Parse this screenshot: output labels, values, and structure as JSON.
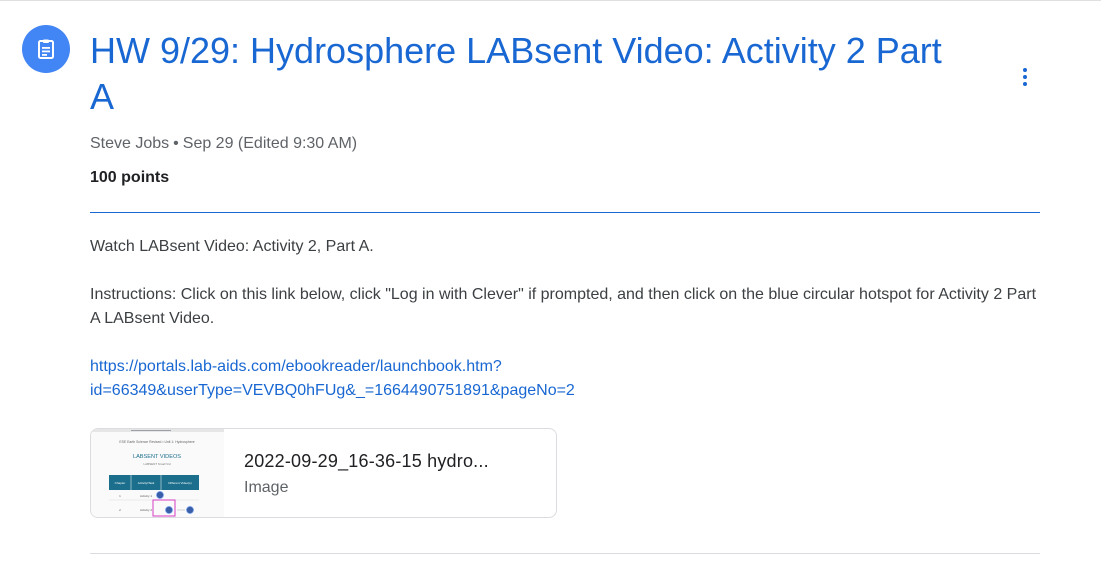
{
  "header": {
    "title": "HW 9/29: Hydrosphere LABsent Video: Activity 2 Part A",
    "icon": "assignment-icon",
    "more_icon": "more-vert-icon"
  },
  "meta": {
    "author": "Steve Jobs",
    "separator": "•",
    "date": "Sep 29 (Edited 9:30 AM)"
  },
  "points": "100 points",
  "description": {
    "line1": "Watch LABsent Video: Activity 2, Part A.",
    "instructions": "Instructions: Click on this link below, click \"Log in with Clever\" if prompted, and then click on the blue circular hotspot for Activity 2 Part A LABsent Video.",
    "link_line1": "https://portals.lab-aids.com/ebookreader/launchbook.htm?",
    "link_line2": "id=66349&userType=VEVBQ0hFUg&_=1664490751891&pageNo=2"
  },
  "attachment": {
    "name": "2022-09-29_16-36-15 hydro...",
    "type": "Image",
    "thumbnail": {
      "course": "ESE Earth Science Revised • Unit 1: Hydrosphere",
      "heading": "LABSENT VIDEOS",
      "subheading": "LABSENT Small Vid",
      "columns": [
        "Chapter",
        "Activity/Task",
        "Different Video(s)"
      ],
      "rows": [
        [
          "1",
          "Activity 1"
        ],
        [
          "2",
          "Activity 2"
        ]
      ]
    }
  },
  "colors": {
    "accent": "#1967d2",
    "icon_bg": "#4285f4",
    "thumb_header": "#1c6f8c"
  }
}
